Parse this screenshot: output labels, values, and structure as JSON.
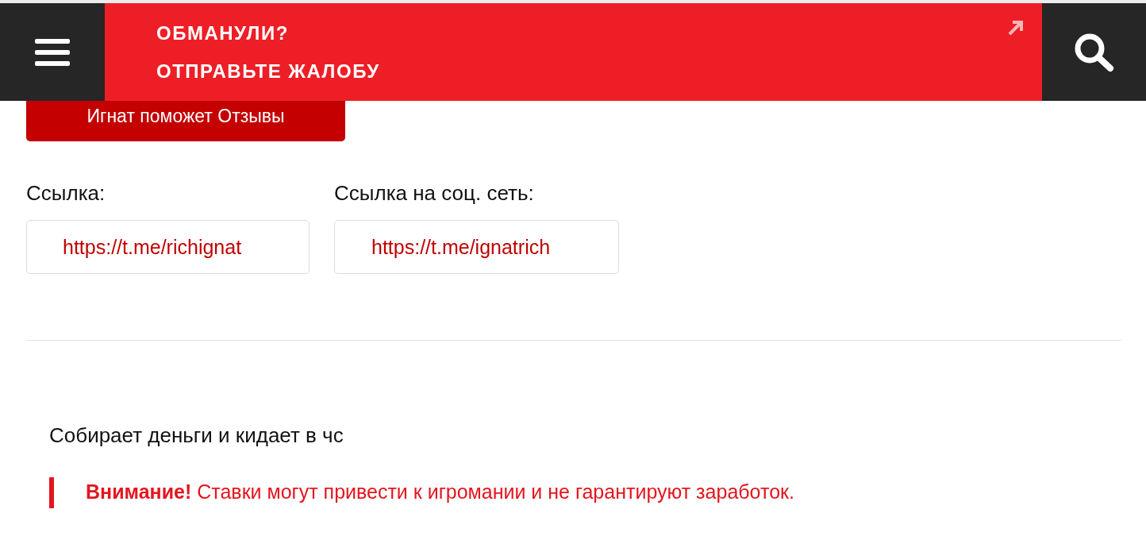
{
  "header": {
    "promo_lines": [
      "ОБМАНУЛИ?",
      "ОТПРАВЬТЕ ЖАЛОБУ"
    ]
  },
  "category_button": "Игнат поможет Отзывы",
  "links": [
    {
      "label": "Ссылка:",
      "value": "https://t.me/richignat"
    },
    {
      "label": "Ссылка на соц. сеть:",
      "value": "https://t.me/ignatrich"
    }
  ],
  "review_text": "Собирает деньги и кидает в чс",
  "warning": "**Внимание!** Ставки могут привести к игромании и не гарантируют заработок."
}
